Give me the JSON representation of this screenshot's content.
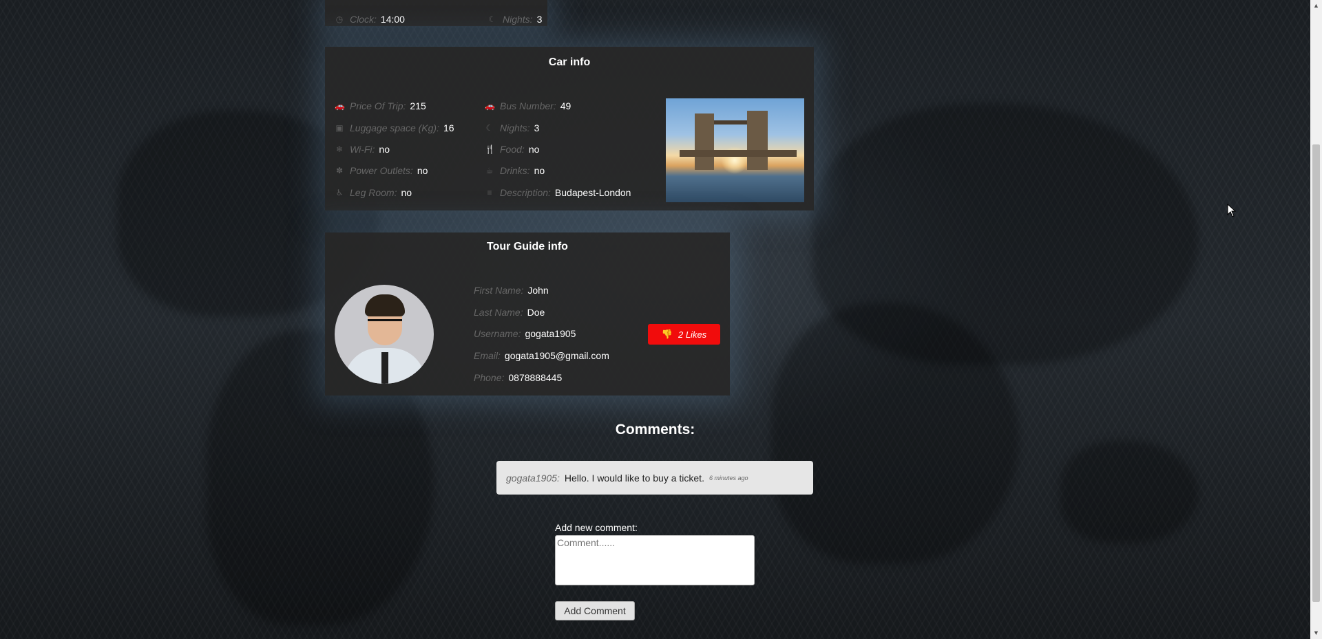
{
  "top_card": {
    "clock": {
      "label": "Clock:",
      "value": "14:00",
      "icon": "clock-icon"
    },
    "nights": {
      "label": "Nights:",
      "value": "3",
      "icon": "moon-icon"
    }
  },
  "car_info": {
    "title": "Car info",
    "left": [
      {
        "label": "Price Of Trip:",
        "value": "215",
        "icon": "car-icon"
      },
      {
        "label": "Luggage space (Kg):",
        "value": "16",
        "icon": "suitcase-icon"
      },
      {
        "label": "Wi-Fi:",
        "value": "no",
        "icon": "snowflake-icon"
      },
      {
        "label": "Power Outlets:",
        "value": "no",
        "icon": "paw-icon"
      },
      {
        "label": "Leg Room:",
        "value": "no",
        "icon": "seat-icon"
      }
    ],
    "right": [
      {
        "label": "Bus Number:",
        "value": "49",
        "icon": "car-icon"
      },
      {
        "label": "Nights:",
        "value": "3",
        "icon": "moon-icon"
      },
      {
        "label": "Food:",
        "value": "no",
        "icon": "utensils-icon"
      },
      {
        "label": "Drinks:",
        "value": "no",
        "icon": "coffee-icon"
      },
      {
        "label": "Description:",
        "value": "Budapest-London",
        "icon": "align-left-icon"
      }
    ]
  },
  "guide_info": {
    "title": "Tour Guide info",
    "fields": [
      {
        "label": "First Name:",
        "value": "John"
      },
      {
        "label": "Last Name:",
        "value": "Doe"
      },
      {
        "label": "Username:",
        "value": "gogata1905"
      },
      {
        "label": "Email:",
        "value": "gogata1905@gmail.com"
      },
      {
        "label": "Phone:",
        "value": "0878888445"
      }
    ],
    "likes_label": "2 Likes"
  },
  "comments": {
    "title": "Comments:",
    "items": [
      {
        "user": "gogata1905:",
        "text": "Hello. I would like to buy a ticket.",
        "time": "6 minutes ago"
      }
    ],
    "add_label": "Add new comment:",
    "placeholder": "Comment......",
    "button_label": "Add Comment"
  },
  "colors": {
    "like_button": "#f10c0c",
    "panel": "#282828"
  }
}
